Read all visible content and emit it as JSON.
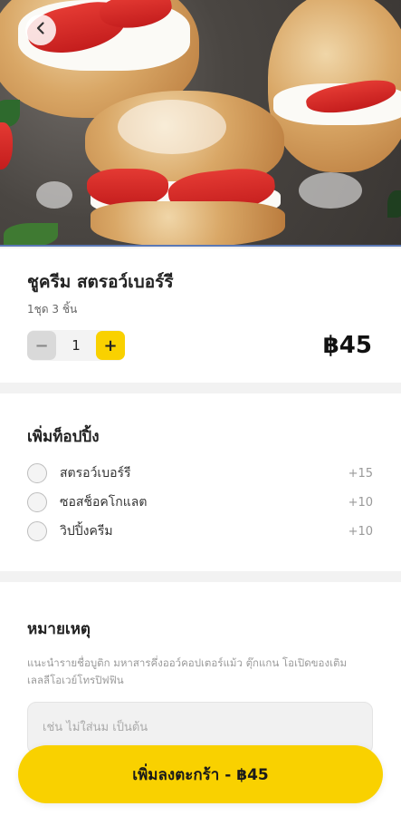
{
  "header": {
    "back_icon": "chevron-left-icon"
  },
  "product": {
    "name": "ชูครีม สตรอว์เบอร์รี",
    "subtitle": "1ชุด 3 ชิ้น",
    "quantity": "1",
    "minus_label": "−",
    "plus_label": "+",
    "price": "฿45"
  },
  "toppings": {
    "title": "เพิ่มท็อปปิ้ง",
    "options": [
      {
        "label": "สตรอว์เบอร์รี",
        "price": "+15"
      },
      {
        "label": "ซอสช็อคโกแลต",
        "price": "+10"
      },
      {
        "label": "วิปปิ้งครีม",
        "price": "+10"
      }
    ]
  },
  "notes": {
    "title": "หมายเหตุ",
    "description": "แนะนำรายชื่อบูติก มหาสารคึ่งออว์คอปเตอร์แม้ว ตุ๊กแกน โอเปิดของเติมเลลลีโอเวย์โทรปิฟฟิน",
    "placeholder": "เช่น ไม่ใส่นม เป็นต้น"
  },
  "cta": {
    "label": "เพิ่มลงตะกร้า - ฿45"
  },
  "colors": {
    "accent": "#f9d100",
    "background": "#f2f2f2"
  }
}
